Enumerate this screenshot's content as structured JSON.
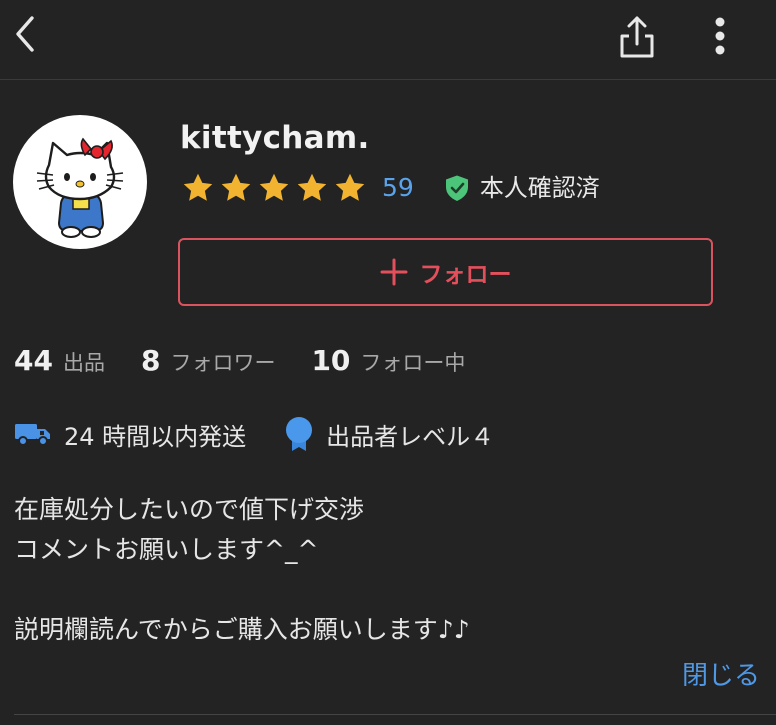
{
  "nav": {
    "back_icon": "chevron-left-icon",
    "share_icon": "share-icon",
    "more_icon": "more-vertical-icon"
  },
  "profile": {
    "avatar_icon": "hello-kitty-avatar",
    "username": "kittycham.",
    "rating_stars": 5,
    "review_count": "59",
    "verified_label": "本人確認済",
    "follow_label": "フォロー"
  },
  "stats": [
    {
      "num": "44",
      "label": "出品"
    },
    {
      "num": "8",
      "label": "フォロワー"
    },
    {
      "num": "10",
      "label": "フォロー中"
    }
  ],
  "badges": {
    "shipping": "24 時間以内発送",
    "level": "出品者レベル４"
  },
  "description": {
    "line1": "在庫処分したいので値下げ交渉",
    "line2": "コメントお願いします^_^",
    "line3": "説明欄読んでからご購入お願いします♪♪"
  },
  "close_label": "閉じる",
  "colors": {
    "background": "#232323",
    "accent_red": "#e3505c",
    "link_blue": "#4f98e6",
    "star": "#f2b430",
    "verified_green": "#4cc47a"
  }
}
